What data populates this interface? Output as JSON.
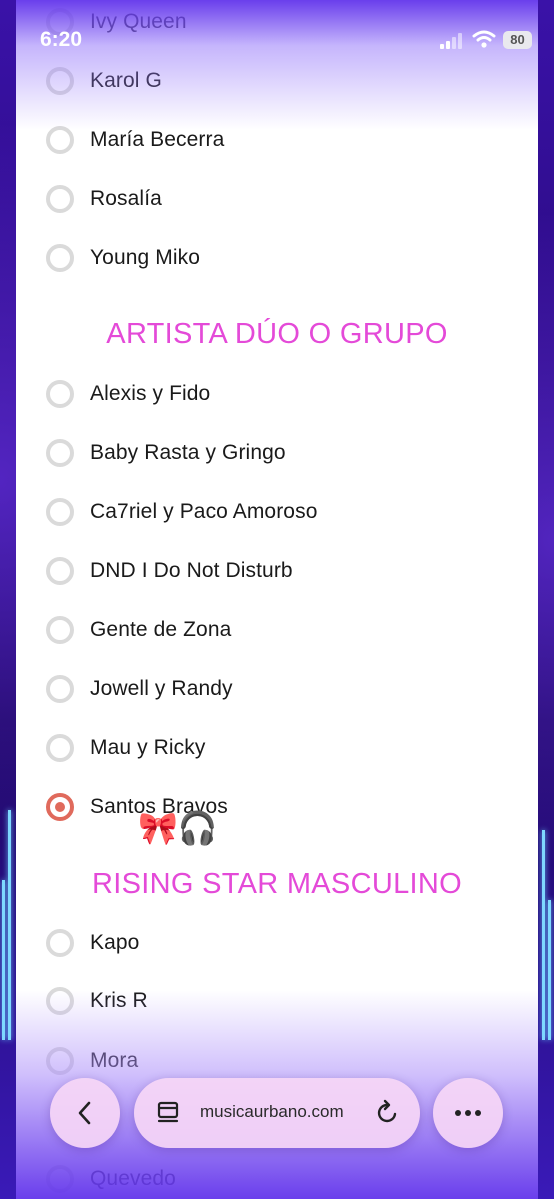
{
  "status_bar": {
    "time": "6:20",
    "battery": "80"
  },
  "sections": {
    "female_artists": [
      {
        "label": "Ivy Queen",
        "checked": false
      },
      {
        "label": "Karol G",
        "checked": false
      },
      {
        "label": "María Becerra",
        "checked": false
      },
      {
        "label": "Rosalía",
        "checked": false
      },
      {
        "label": "Young Miko",
        "checked": false
      }
    ],
    "duo_title": "ARTISTA DÚO O GRUPO",
    "duo": [
      {
        "label": "Alexis y Fido",
        "checked": false
      },
      {
        "label": "Baby Rasta y Gringo",
        "checked": false
      },
      {
        "label": "Ca7riel y Paco Amoroso",
        "checked": false
      },
      {
        "label": "DND I Do Not Disturb",
        "checked": false
      },
      {
        "label": "Gente de Zona",
        "checked": false
      },
      {
        "label": "Jowell y Randy",
        "checked": false
      },
      {
        "label": "Mau y Ricky",
        "checked": false
      },
      {
        "label": "Santos Bravos",
        "checked": true
      }
    ],
    "sticker_emojis": "🎀🎧",
    "rising_title": "RISING STAR MASCULINO",
    "rising": [
      {
        "label": "Kapo",
        "checked": false
      },
      {
        "label": "Kris R",
        "checked": false
      },
      {
        "label": "Mora",
        "checked": false
      },
      {
        "label": "Quevedo",
        "checked": false
      }
    ]
  },
  "browser_bar": {
    "url": "musicaurbano.com"
  },
  "colors": {
    "accent": "#e44ad8",
    "radio_checked": "#e06a5c",
    "backdrop": "#2a0a80"
  }
}
